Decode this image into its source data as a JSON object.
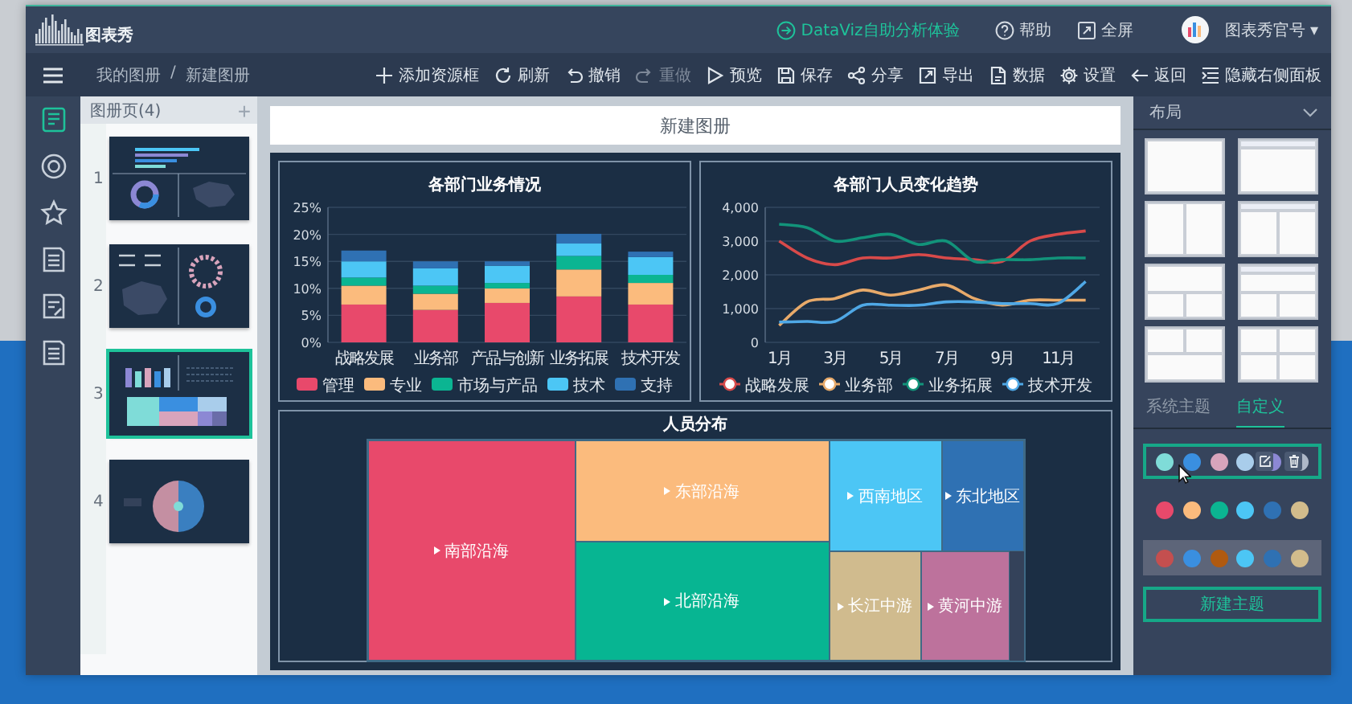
{
  "header": {
    "logo": "图表秀",
    "link": "DataViz自助分析体验",
    "help": "帮助",
    "fullscreen": "全屏",
    "user": "图表秀官号",
    "caret": "▾"
  },
  "toolbar": {
    "breadcrumb": [
      "我的图册",
      "新建图册"
    ],
    "separator": "/",
    "items": [
      {
        "kind": "add",
        "label": "添加资源框",
        "disabled": false
      },
      {
        "kind": "refresh",
        "label": "刷新",
        "disabled": false
      },
      {
        "kind": "undo",
        "label": "撤销",
        "disabled": false
      },
      {
        "kind": "redo",
        "label": "重做",
        "disabled": true
      },
      {
        "kind": "preview",
        "label": "预览",
        "disabled": false
      },
      {
        "kind": "save",
        "label": "保存",
        "disabled": false
      },
      {
        "kind": "share",
        "label": "分享",
        "disabled": false
      },
      {
        "kind": "export",
        "label": "导出",
        "disabled": false
      },
      {
        "kind": "data",
        "label": "数据",
        "disabled": false
      },
      {
        "kind": "settings",
        "label": "设置",
        "disabled": false
      },
      {
        "kind": "back",
        "label": "返回",
        "disabled": false
      },
      {
        "kind": "panel",
        "label": "隐藏右侧面板",
        "disabled": false
      }
    ]
  },
  "sidebar": {
    "items": [
      {
        "kind": "pages",
        "selected": true
      },
      {
        "kind": "target",
        "selected": false
      },
      {
        "kind": "star",
        "selected": false
      },
      {
        "kind": "doc",
        "selected": false
      },
      {
        "kind": "doc-edit",
        "selected": false
      },
      {
        "kind": "doc",
        "selected": false
      }
    ]
  },
  "pages_panel": {
    "title": "图册页(4)",
    "add": "+",
    "pages": [
      {
        "number": "1",
        "kind": "donut-map",
        "selected": false
      },
      {
        "number": "2",
        "kind": "map-radial",
        "selected": false
      },
      {
        "number": "3",
        "kind": "bar-treemap",
        "selected": true
      },
      {
        "number": "4",
        "kind": "sunburst",
        "selected": false
      }
    ]
  },
  "canvas": {
    "title": "新建图册",
    "bar_panel": {
      "chart_data": {
        "type": "bar",
        "title": "各部门业务情况",
        "stacked": true,
        "grid": true,
        "legend": true,
        "categories": [
          "战略发展",
          "业务部",
          "产品与创新",
          "业务拓展",
          "技术开发"
        ],
        "ylim": [
          0,
          25
        ],
        "yticks": [
          {
            "value": 0,
            "label": "0%"
          },
          {
            "value": 5,
            "label": "5%"
          },
          {
            "value": 10,
            "label": "10%"
          },
          {
            "value": 15,
            "label": "15%"
          },
          {
            "value": 20,
            "label": "20%"
          },
          {
            "value": 25,
            "label": "25%"
          }
        ],
        "series": [
          {
            "name": "管理",
            "color": "#e8496b",
            "values": [
              7,
              6,
              7.3,
              8.5,
              7
            ]
          },
          {
            "name": "专业",
            "color": "#fbbb7d",
            "values": [
              3.5,
              3,
              2.7,
              5,
              4
            ]
          },
          {
            "name": "市场与产品",
            "color": "#0bb592",
            "values": [
              1.5,
              1.5,
              1,
              2.5,
              1.5
            ]
          },
          {
            "name": "技术",
            "color": "#4cc6f5",
            "values": [
              3,
              3.2,
              3.2,
              2.3,
              3.3
            ]
          },
          {
            "name": "支持",
            "color": "#2f71b3",
            "values": [
              2,
              1.3,
              0.8,
              1.8,
              1
            ]
          }
        ]
      }
    },
    "line_panel": {
      "chart_data": {
        "type": "line",
        "title": "各部门人员变化趋势",
        "grid": true,
        "legend": true,
        "x": [
          1,
          2,
          3,
          4,
          5,
          6,
          7,
          8,
          9,
          10,
          11,
          12
        ],
        "xlim": [
          0.5,
          12.5
        ],
        "xticks": [
          {
            "value": 1,
            "label": "1月"
          },
          {
            "value": 3,
            "label": "3月"
          },
          {
            "value": 5,
            "label": "5月"
          },
          {
            "value": 7,
            "label": "7月"
          },
          {
            "value": 9,
            "label": "9月"
          },
          {
            "value": 11,
            "label": "11月"
          }
        ],
        "ylim": [
          0,
          4000
        ],
        "yticks": [
          {
            "value": 0,
            "label": "0"
          },
          {
            "value": 1000,
            "label": "1,000"
          },
          {
            "value": 2000,
            "label": "2,000"
          },
          {
            "value": 3000,
            "label": "3,000"
          },
          {
            "value": 4000,
            "label": "4,000"
          }
        ],
        "series": [
          {
            "name": "战略发展",
            "color": "#d84a4a",
            "values": [
              3000,
              2500,
              2300,
              2500,
              2500,
              2600,
              2500,
              2450,
              2400,
              3000,
              3200,
              3300
            ]
          },
          {
            "name": "业务部",
            "color": "#e8aa6a",
            "values": [
              500,
              1200,
              1300,
              1550,
              1400,
              1550,
              1700,
              1300,
              1100,
              1250,
              1250,
              1250
            ]
          },
          {
            "name": "业务拓展",
            "color": "#12937a",
            "values": [
              3500,
              3400,
              3000,
              3100,
              3200,
              2900,
              3000,
              2400,
              2450,
              2450,
              2500,
              2500
            ]
          },
          {
            "name": "技术开发",
            "color": "#4fa8e6",
            "values": [
              600,
              620,
              620,
              1100,
              1100,
              1100,
              1200,
              1200,
              1150,
              1150,
              1150,
              1800
            ]
          }
        ]
      }
    },
    "treemap": {
      "title": "人员分布",
      "tiles": [
        {
          "label": "南部沿海",
          "color": "#e8496b"
        },
        {
          "label": "东部沿海",
          "color": "#fbbb7d"
        },
        {
          "label": "西南地区",
          "color": "#4cc6f5"
        },
        {
          "label": "东北地区",
          "color": "#2f71b3"
        },
        {
          "label": "北部沿海",
          "color": "#07b592"
        },
        {
          "label": "长江中游",
          "color": "#d0bb8e"
        },
        {
          "label": "黄河中游",
          "color": "#bd729c"
        }
      ]
    }
  },
  "right_panel": {
    "title": "布局",
    "layouts": [
      {
        "kind": "full"
      },
      {
        "kind": "header-full"
      },
      {
        "kind": "split"
      },
      {
        "kind": "header-split"
      },
      {
        "kind": "wide-over-pair"
      },
      {
        "kind": "header-wide-over-pair"
      },
      {
        "kind": "pair-over-wide"
      },
      {
        "kind": "quad"
      }
    ],
    "tabs": [
      {
        "label": "系统主题",
        "selected": false
      },
      {
        "label": "自定义",
        "selected": true
      }
    ],
    "themes": [
      {
        "selected": true,
        "shaded": false,
        "swatches": [
          {
            "color": "#7fdcd8"
          },
          {
            "color": "#3a8fe0"
          },
          {
            "color": "#d8a4bc"
          },
          {
            "color": "#a9cdeb"
          },
          {
            "color": "#8c88d4"
          },
          {
            "color": "#aeb8c8"
          }
        ]
      },
      {
        "selected": false,
        "shaded": false,
        "swatches": [
          {
            "color": "#e8496b"
          },
          {
            "color": "#fbbb7d"
          },
          {
            "color": "#0bb592"
          },
          {
            "color": "#4cc6f5"
          },
          {
            "color": "#2f71b3"
          },
          {
            "color": "#d2bc8c"
          }
        ]
      },
      {
        "selected": false,
        "shaded": true,
        "swatches": [
          {
            "color": "#c44f4f"
          },
          {
            "color": "#3a8fe0"
          },
          {
            "color": "#b05a10"
          },
          {
            "color": "#4cc6f5"
          },
          {
            "color": "#2f71b3"
          },
          {
            "color": "#d2bc8c"
          }
        ]
      }
    ],
    "new_theme": "新建主题"
  }
}
